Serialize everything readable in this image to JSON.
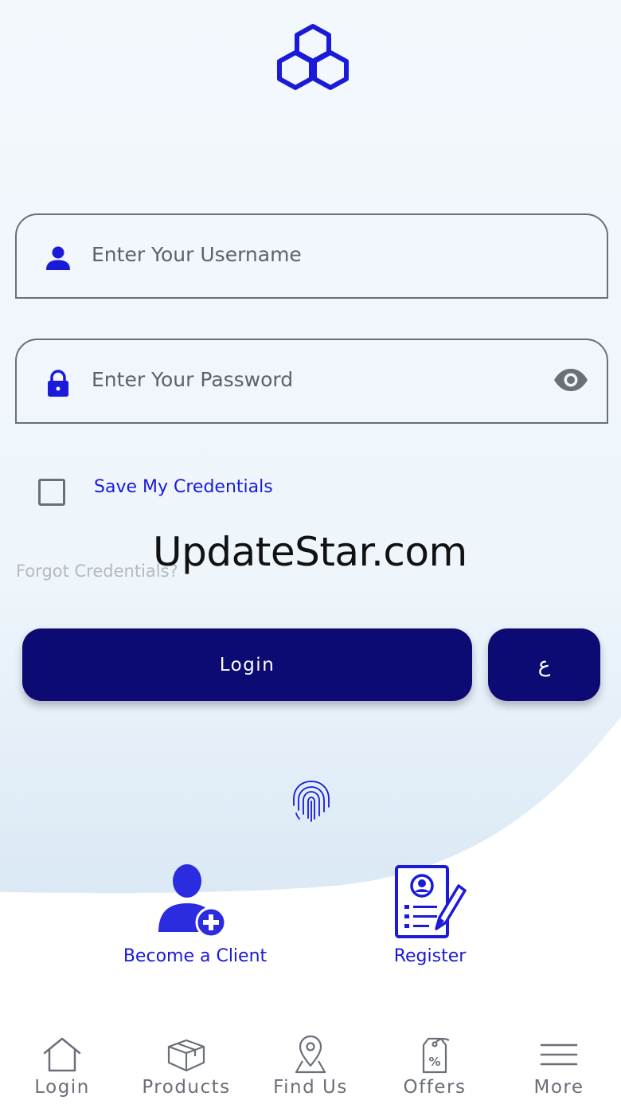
{
  "colors": {
    "accent": "#1a1ad8",
    "button": "#0b0b73",
    "field_border": "#6a6f78",
    "nav_text": "#6a6f78"
  },
  "form": {
    "username_placeholder": "Enter Your Username",
    "username_value": "",
    "password_placeholder": "Enter Your Password",
    "password_value": "",
    "save_credentials_label": "Save My Credentials",
    "save_credentials_checked": false,
    "forgot_label": "Forgot Credentials?"
  },
  "watermark": "UpdateStar.com",
  "buttons": {
    "login_label": "Login",
    "language_label": "ع"
  },
  "actions": {
    "become_client_label": "Become a Client",
    "register_label": "Register"
  },
  "nav": {
    "items": [
      {
        "label": "Login",
        "icon": "home-icon"
      },
      {
        "label": "Products",
        "icon": "box-icon"
      },
      {
        "label": "Find Us",
        "icon": "location-pin-icon"
      },
      {
        "label": "Offers",
        "icon": "price-tag-icon"
      },
      {
        "label": "More",
        "icon": "menu-icon"
      }
    ]
  }
}
